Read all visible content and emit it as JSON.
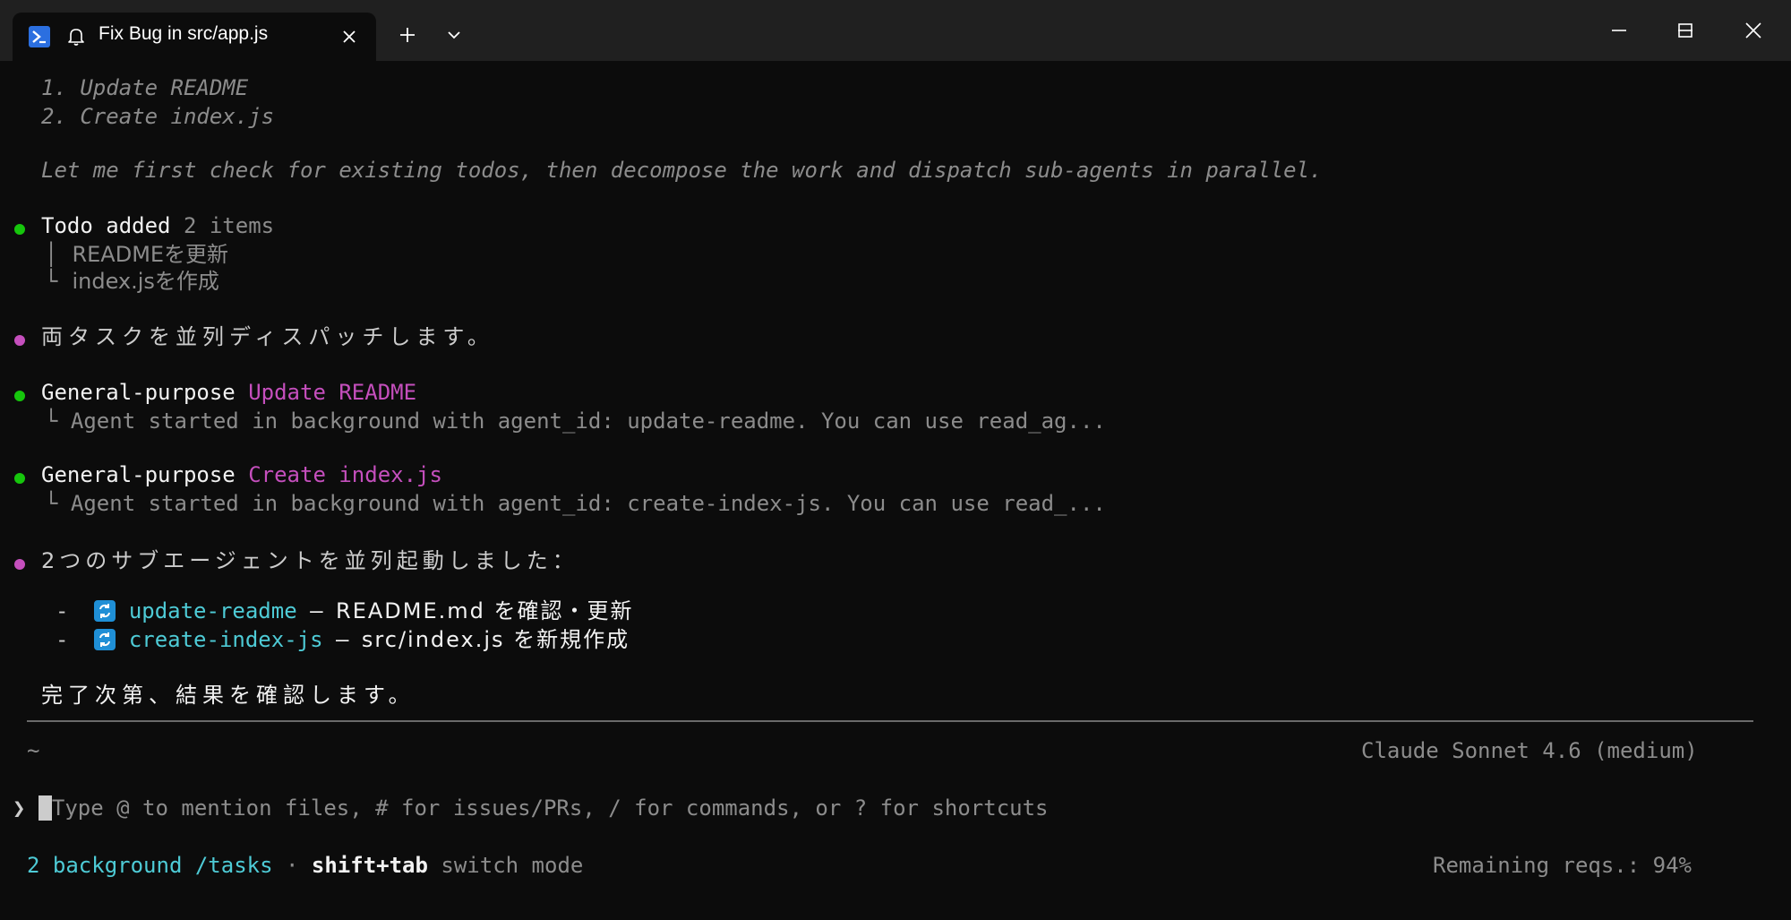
{
  "titlebar": {
    "tab_title": "Fix Bug in src/app.js",
    "icons": [
      "terminal-shell-icon",
      "bell-icon",
      "close-icon",
      "plus-icon",
      "chevron-down-icon",
      "minimize-icon",
      "maximize-icon",
      "window-close-icon"
    ]
  },
  "terminal": {
    "plan_items": [
      "1. Update README",
      "2. Create index.js"
    ],
    "intro": "Let me first check for existing todos, then decompose the work and dispatch sub-agents in parallel.",
    "todo": {
      "title": "Todo added",
      "count": "2 items",
      "items": [
        "READMEを更新",
        "index.jsを作成"
      ],
      "branch_mid": "│",
      "branch_end": "└"
    },
    "msg_dispatch": "両タスクを並列ディスパッチします。",
    "agents": [
      {
        "type": "General-purpose",
        "name": "Update README",
        "branch": "└",
        "detail": "Agent started in background with agent_id: update-readme. You can use read_ag..."
      },
      {
        "type": "General-purpose",
        "name": "Create index.js",
        "branch": "└",
        "detail": "Agent started in background with agent_id: create-index-js. You can use read_..."
      }
    ],
    "msg_started": "2つのサブエージェントを並列起動しました：",
    "subagents": [
      {
        "bullet": "-",
        "id": "update-readme",
        "dash": "–",
        "desc": "README.md を確認・更新"
      },
      {
        "bullet": "-",
        "id": "create-index-js",
        "dash": "–",
        "desc": "src/index.js を新規作成"
      }
    ],
    "msg_wait": "完了次第、結果を確認します。",
    "cwd": "~",
    "model": "Claude Sonnet 4.6 (medium)",
    "prompt_symbol": "❯",
    "input_placeholder": "Type @ to mention files, # for issues/PRs, / for commands, or ? for shortcuts",
    "footer": {
      "tasks": "2 background /tasks",
      "sep": "·",
      "shortcut": "shift+tab",
      "shortcut_desc": "switch mode",
      "remaining": "Remaining reqs.: 94%"
    }
  },
  "colors": {
    "background": "#0c0c0c",
    "titlebar": "#202020",
    "green": "#16c60c",
    "magenta": "#c54fbd",
    "cyan": "#4ecbd6",
    "dim": "#8c8c8c"
  }
}
